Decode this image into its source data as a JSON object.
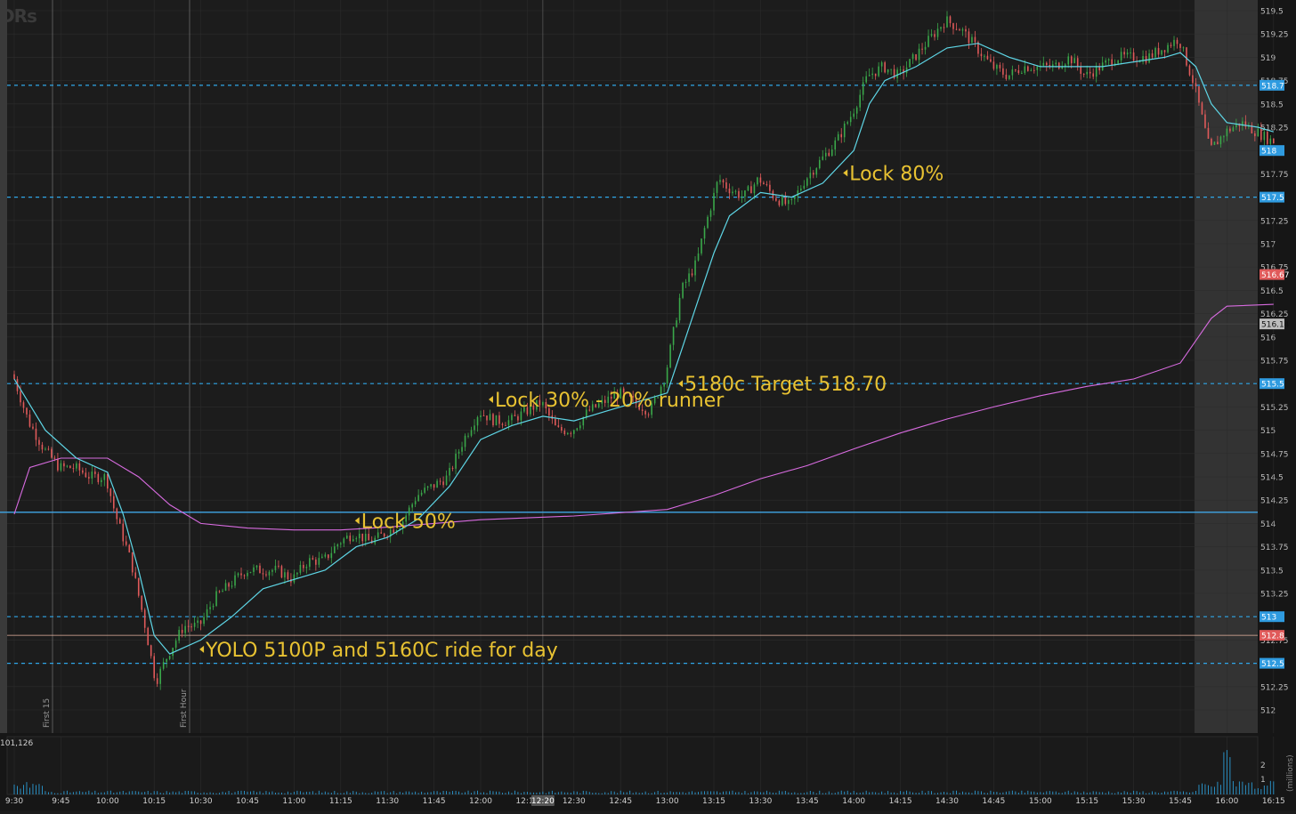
{
  "watermark": "DRs",
  "colors": {
    "background": "#161616",
    "plot_bg": "#1c1c1c",
    "grid": "#2c2c2c",
    "up_candle": "#3aa84a",
    "down_candle": "#e05a5a",
    "ema": "#5ed6e6",
    "vwap": "#d86be0",
    "dashed_level": "#2fa6e8",
    "solid_level": "#3fa6e6",
    "annotation": "#e8c232",
    "tag_blue": "#2f9be0",
    "tag_red": "#e05a5a",
    "tag_gray": "#bdbdbd"
  },
  "price_axis": {
    "ticks": [
      "519.5",
      "519.25",
      "519",
      "518.75",
      "518.5",
      "518.25",
      "518",
      "517.75",
      "517.5",
      "517.25",
      "517",
      "516.75",
      "516.5",
      "516.25",
      "516",
      "515.75",
      "515.5",
      "515.25",
      "515",
      "514.75",
      "514.5",
      "514.25",
      "514",
      "513.75",
      "513.5",
      "513.25",
      "513",
      "512.75",
      "512.5",
      "512.25",
      "512"
    ]
  },
  "time_axis": {
    "ticks": [
      "9:30",
      "9:45",
      "10:00",
      "10:15",
      "10:30",
      "10:45",
      "11:00",
      "11:15",
      "11:30",
      "11:45",
      "12:00",
      "12:15",
      "12:30",
      "12:45",
      "13:00",
      "13:15",
      "13:30",
      "13:45",
      "14:00",
      "14:15",
      "14:30",
      "14:45",
      "15:00",
      "15:15",
      "15:30",
      "15:45",
      "16:00",
      "16:15"
    ],
    "cursor_label": "12:20"
  },
  "vertical_markers": [
    {
      "label": "First 15"
    },
    {
      "label": "First Hour"
    }
  ],
  "price_tags": [
    {
      "text": "518.7",
      "price": 518.7,
      "style": "blue"
    },
    {
      "text": "518",
      "price": 518.0,
      "style": "blue"
    },
    {
      "text": "517.5",
      "price": 517.5,
      "style": "blue"
    },
    {
      "text": "516.67",
      "price": 516.67,
      "style": "red"
    },
    {
      "text": "516.14",
      "price": 516.14,
      "style": "gray"
    },
    {
      "text": "515.5",
      "price": 515.5,
      "style": "blue"
    },
    {
      "text": "513",
      "price": 513.0,
      "style": "blue"
    },
    {
      "text": "512.8",
      "price": 512.8,
      "style": "red"
    },
    {
      "text": "512.5",
      "price": 512.5,
      "style": "blue"
    }
  ],
  "volume_panel": {
    "label": "101,126",
    "ticks": [
      "2",
      "1"
    ],
    "side_label": "(millions)"
  },
  "annotations": [
    {
      "text": "YOLO 5100P and 5160C ride for day",
      "time": "10:31",
      "price": 512.65
    },
    {
      "text": "Lock 50%",
      "time": "11:21",
      "price": 514.03
    },
    {
      "text": "Lock 30% - 20% runner",
      "time": "12:04",
      "price": 515.33
    },
    {
      "text": "5180c Target 518.70",
      "time": "13:05",
      "price": 515.5
    },
    {
      "text": "Lock 80%",
      "time": "13:58",
      "price": 517.76
    }
  ],
  "chart_data": {
    "type": "candlestick",
    "title": "",
    "xlabel": "",
    "ylabel": "",
    "ylim": [
      511.9,
      519.6
    ],
    "x_range": [
      "9:30",
      "16:15"
    ],
    "grid": true,
    "extended_hours_shading": [
      "15:55",
      "16:20"
    ],
    "price_path": [
      [
        "9:30",
        515.6
      ],
      [
        "9:35",
        515.1
      ],
      [
        "9:40",
        514.8
      ],
      [
        "9:45",
        514.6
      ],
      [
        "9:50",
        514.6
      ],
      [
        "9:55",
        514.5
      ],
      [
        "10:00",
        514.5
      ],
      [
        "10:03",
        514.1
      ],
      [
        "10:08",
        513.6
      ],
      [
        "10:12",
        513.0
      ],
      [
        "10:16",
        512.3
      ],
      [
        "10:20",
        512.6
      ],
      [
        "10:25",
        512.9
      ],
      [
        "10:30",
        512.9
      ],
      [
        "10:35",
        513.2
      ],
      [
        "10:45",
        513.5
      ],
      [
        "10:55",
        513.5
      ],
      [
        "11:00",
        513.4
      ],
      [
        "11:05",
        513.6
      ],
      [
        "11:10",
        513.6
      ],
      [
        "11:15",
        513.8
      ],
      [
        "11:20",
        513.9
      ],
      [
        "11:25",
        513.8
      ],
      [
        "11:30",
        513.9
      ],
      [
        "11:35",
        514.0
      ],
      [
        "11:40",
        514.3
      ],
      [
        "11:45",
        514.4
      ],
      [
        "11:50",
        514.5
      ],
      [
        "11:55",
        514.9
      ],
      [
        "12:00",
        515.2
      ],
      [
        "12:05",
        515.1
      ],
      [
        "12:10",
        515.1
      ],
      [
        "12:15",
        515.2
      ],
      [
        "12:20",
        515.3
      ],
      [
        "12:25",
        515.0
      ],
      [
        "12:30",
        515.0
      ],
      [
        "12:35",
        515.2
      ],
      [
        "12:40",
        515.3
      ],
      [
        "12:45",
        515.4
      ],
      [
        "12:50",
        515.3
      ],
      [
        "12:55",
        515.2
      ],
      [
        "13:00",
        515.6
      ],
      [
        "13:05",
        516.5
      ],
      [
        "13:10",
        516.8
      ],
      [
        "13:12",
        517.1
      ],
      [
        "13:17",
        517.7
      ],
      [
        "13:20",
        517.6
      ],
      [
        "13:25",
        517.5
      ],
      [
        "13:30",
        517.7
      ],
      [
        "13:35",
        517.5
      ],
      [
        "13:40",
        517.4
      ],
      [
        "13:45",
        517.7
      ],
      [
        "13:50",
        517.9
      ],
      [
        "13:55",
        518.1
      ],
      [
        "14:00",
        518.4
      ],
      [
        "14:05",
        518.8
      ],
      [
        "14:10",
        518.9
      ],
      [
        "14:15",
        518.8
      ],
      [
        "14:20",
        519.0
      ],
      [
        "14:25",
        519.2
      ],
      [
        "14:30",
        519.4
      ],
      [
        "14:35",
        519.3
      ],
      [
        "14:40",
        519.1
      ],
      [
        "14:45",
        518.9
      ],
      [
        "14:50",
        518.8
      ],
      [
        "14:55",
        518.9
      ],
      [
        "15:00",
        518.9
      ],
      [
        "15:05",
        518.9
      ],
      [
        "15:10",
        519.0
      ],
      [
        "15:15",
        518.8
      ],
      [
        "15:20",
        518.9
      ],
      [
        "15:25",
        519.0
      ],
      [
        "15:30",
        519.0
      ],
      [
        "15:35",
        519.0
      ],
      [
        "15:40",
        519.1
      ],
      [
        "15:45",
        519.2
      ],
      [
        "15:50",
        518.7
      ],
      [
        "15:55",
        518.0
      ],
      [
        "16:00",
        518.2
      ],
      [
        "16:05",
        518.3
      ],
      [
        "16:10",
        518.2
      ],
      [
        "16:15",
        518.1
      ]
    ],
    "ema_path": [
      [
        "9:30",
        515.55
      ],
      [
        "9:40",
        515.0
      ],
      [
        "9:50",
        514.7
      ],
      [
        "10:00",
        514.55
      ],
      [
        "10:05",
        514.1
      ],
      [
        "10:10",
        513.5
      ],
      [
        "10:15",
        512.8
      ],
      [
        "10:20",
        512.6
      ],
      [
        "10:30",
        512.75
      ],
      [
        "10:40",
        513.0
      ],
      [
        "10:50",
        513.3
      ],
      [
        "11:00",
        513.4
      ],
      [
        "11:10",
        513.5
      ],
      [
        "11:20",
        513.75
      ],
      [
        "11:30",
        513.85
      ],
      [
        "11:40",
        514.05
      ],
      [
        "11:50",
        514.4
      ],
      [
        "12:00",
        514.9
      ],
      [
        "12:10",
        515.05
      ],
      [
        "12:20",
        515.15
      ],
      [
        "12:30",
        515.1
      ],
      [
        "12:40",
        515.2
      ],
      [
        "12:50",
        515.3
      ],
      [
        "13:00",
        515.4
      ],
      [
        "13:05",
        515.9
      ],
      [
        "13:10",
        516.4
      ],
      [
        "13:15",
        516.9
      ],
      [
        "13:20",
        517.3
      ],
      [
        "13:30",
        517.55
      ],
      [
        "13:40",
        517.5
      ],
      [
        "13:50",
        517.65
      ],
      [
        "14:00",
        518.0
      ],
      [
        "14:05",
        518.5
      ],
      [
        "14:10",
        518.75
      ],
      [
        "14:20",
        518.9
      ],
      [
        "14:30",
        519.1
      ],
      [
        "14:40",
        519.15
      ],
      [
        "14:50",
        519.0
      ],
      [
        "15:00",
        518.9
      ],
      [
        "15:10",
        518.9
      ],
      [
        "15:20",
        518.9
      ],
      [
        "15:30",
        518.95
      ],
      [
        "15:40",
        519.0
      ],
      [
        "15:45",
        519.05
      ],
      [
        "15:50",
        518.9
      ],
      [
        "15:55",
        518.5
      ],
      [
        "16:00",
        518.3
      ],
      [
        "16:10",
        518.25
      ],
      [
        "16:15",
        518.2
      ]
    ],
    "vwap_path": [
      [
        "9:30",
        514.1
      ],
      [
        "9:35",
        514.6
      ],
      [
        "9:45",
        514.7
      ],
      [
        "10:00",
        514.7
      ],
      [
        "10:10",
        514.5
      ],
      [
        "10:20",
        514.2
      ],
      [
        "10:30",
        514.0
      ],
      [
        "10:45",
        513.95
      ],
      [
        "11:00",
        513.93
      ],
      [
        "11:15",
        513.93
      ],
      [
        "11:30",
        513.96
      ],
      [
        "11:45",
        514.0
      ],
      [
        "12:00",
        514.04
      ],
      [
        "12:30",
        514.08
      ],
      [
        "13:00",
        514.15
      ],
      [
        "13:15",
        514.3
      ],
      [
        "13:30",
        514.48
      ],
      [
        "13:45",
        514.62
      ],
      [
        "14:00",
        514.8
      ],
      [
        "14:15",
        514.97
      ],
      [
        "14:30",
        515.12
      ],
      [
        "14:45",
        515.25
      ],
      [
        "15:00",
        515.37
      ],
      [
        "15:15",
        515.47
      ],
      [
        "15:30",
        515.55
      ],
      [
        "15:45",
        515.72
      ],
      [
        "15:55",
        516.2
      ],
      [
        "16:00",
        516.33
      ],
      [
        "16:15",
        516.35
      ]
    ],
    "levels": [
      {
        "price": 518.7,
        "style": "dashed"
      },
      {
        "price": 517.5,
        "style": "dashed"
      },
      {
        "price": 515.5,
        "style": "dashed"
      },
      {
        "price": 514.12,
        "style": "solid"
      },
      {
        "price": 513.0,
        "style": "dashed"
      },
      {
        "price": 512.8,
        "style": "thin"
      },
      {
        "price": 512.5,
        "style": "dashed"
      },
      {
        "price": 516.14,
        "style": "gray"
      }
    ],
    "volume": {
      "max_millions": 2.4,
      "spike_at": "16:00",
      "spike_value": 2.3
    }
  }
}
